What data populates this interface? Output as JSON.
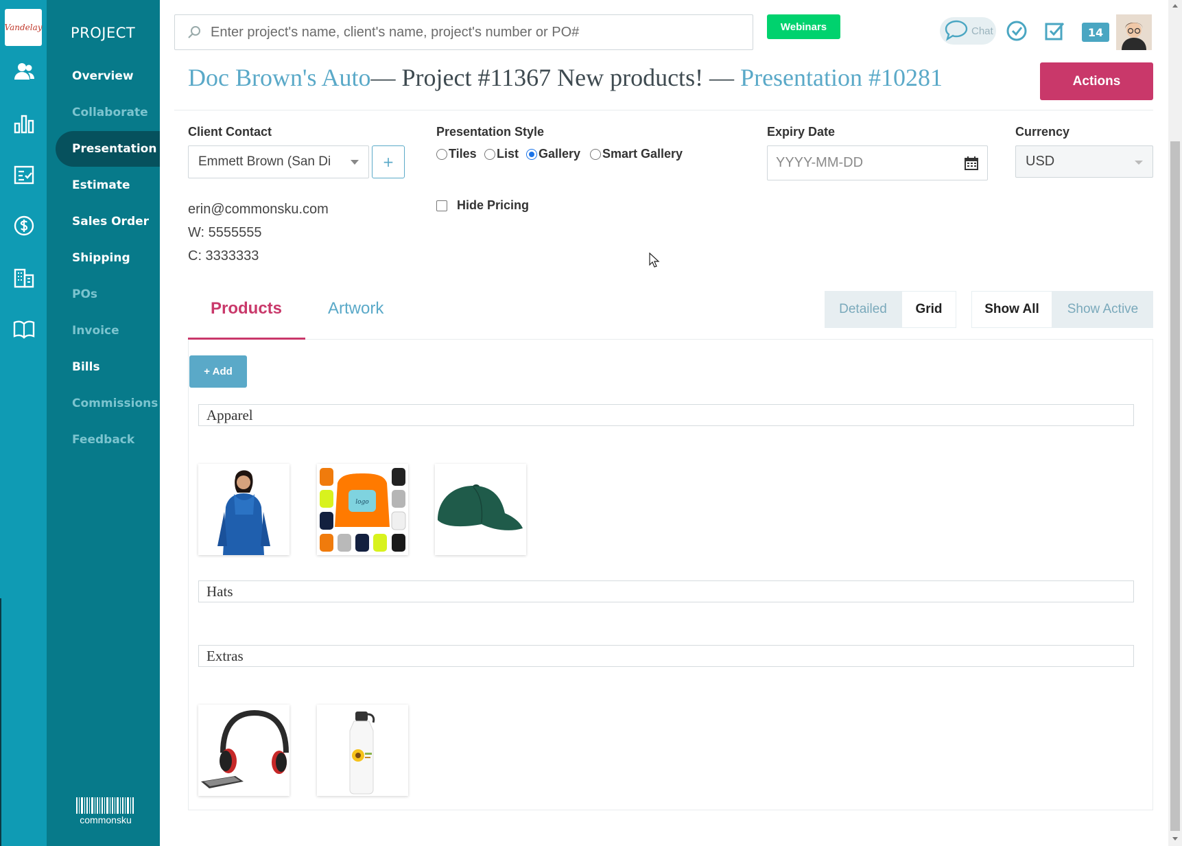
{
  "rail": {
    "logo_text": "Vandelay",
    "icons": [
      "users-icon",
      "bar-chart-icon",
      "checklist-icon",
      "dollar-icon",
      "building-icon",
      "book-icon"
    ]
  },
  "nav": {
    "heading": "PROJECT",
    "items": [
      {
        "label": "Overview",
        "state": "enabled"
      },
      {
        "label": "Collaborate",
        "state": "dim"
      },
      {
        "label": "Presentation",
        "state": "active"
      },
      {
        "label": "Estimate",
        "state": "enabled"
      },
      {
        "label": "Sales Order",
        "state": "enabled"
      },
      {
        "label": "Shipping",
        "state": "enabled"
      },
      {
        "label": "POs",
        "state": "dim"
      },
      {
        "label": "Invoice",
        "state": "dim"
      },
      {
        "label": "Bills",
        "state": "enabled"
      },
      {
        "label": "Commissions",
        "state": "dim"
      },
      {
        "label": "Feedback",
        "state": "dim"
      }
    ],
    "footer_logo": "commonsku"
  },
  "topbar": {
    "search_placeholder": "Enter project's name, client's name, project's number or PO#",
    "webinars_label": "Webinars",
    "chat_label": "Chat",
    "notification_count": "14"
  },
  "title": {
    "client": "Doc Brown's Auto",
    "project": "— Project #11367 New products! — ",
    "presentation": "Presentation #10281"
  },
  "actions_label": "Actions",
  "form": {
    "client_contact_label": "Client Contact",
    "client_contact_value": "Emmett Brown (San Di",
    "add_contact_label": "+",
    "contact_email": "erin@commonsku.com",
    "contact_work": "W: 5555555",
    "contact_cell": "C: 3333333",
    "presentation_style_label": "Presentation Style",
    "styles": [
      {
        "label": "Tiles",
        "selected": false
      },
      {
        "label": "List",
        "selected": false
      },
      {
        "label": "Gallery",
        "selected": true
      },
      {
        "label": "Smart Gallery",
        "selected": false
      }
    ],
    "hide_pricing_label": "Hide Pricing",
    "expiry_date_label": "Expiry Date",
    "expiry_date_placeholder": "YYYY-MM-DD",
    "currency_label": "Currency",
    "currency_value": "USD"
  },
  "tabs": [
    {
      "label": "Products",
      "active": true
    },
    {
      "label": "Artwork",
      "active": false
    }
  ],
  "view_toggle": {
    "detailed": "Detailed",
    "grid": "Grid",
    "active": "Grid"
  },
  "filter_toggle": {
    "show_all": "Show All",
    "show_active": "Show Active",
    "active": "Show All"
  },
  "add_label": "+ Add",
  "sections": [
    {
      "title": "Apparel",
      "products": [
        "blue-wrap-sweater",
        "orange-sweatshirts",
        "green-cap"
      ]
    },
    {
      "title": "Hats",
      "products": []
    },
    {
      "title": "Extras",
      "products": [
        "headphones",
        "white-water-bottle"
      ]
    }
  ],
  "colors": {
    "rail": "#0f9bb4",
    "nav": "#077a8a",
    "nav_active": "#06515d",
    "accent_pink": "#c9386a",
    "link_blue": "#5aa9c8",
    "webinars_green": "#00d26e"
  }
}
